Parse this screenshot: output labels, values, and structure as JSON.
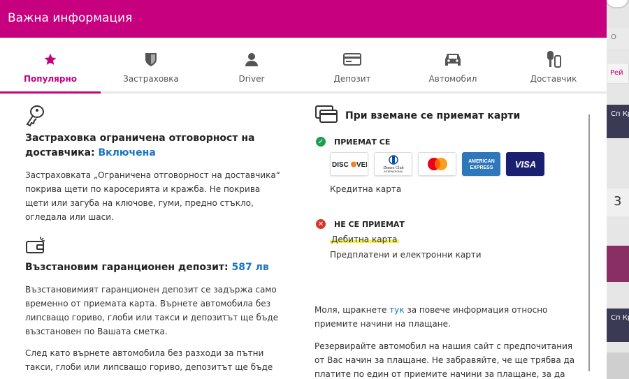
{
  "modal": {
    "title": "Важна информация"
  },
  "tabs": [
    {
      "label": "Популярно",
      "icon": "star-icon",
      "active": true
    },
    {
      "label": "Застраховка",
      "icon": "shield-icon",
      "active": false
    },
    {
      "label": "Driver",
      "icon": "person-icon",
      "active": false
    },
    {
      "label": "Депозит",
      "icon": "card-icon",
      "active": false
    },
    {
      "label": "Автомобил",
      "icon": "car-icon",
      "active": false
    },
    {
      "label": "Доставчик",
      "icon": "keys-icon",
      "active": false
    }
  ],
  "insurance": {
    "title": "Застраховка ограничена отговорност на доставчика:",
    "status": "Включена",
    "body": "Застраховката „Ограничена отговорност на доставчика“ покрива щети по каросерията и кражба. Не покрива щети или загуба на ключове, гуми, предно стъкло, огледала или шаси."
  },
  "deposit": {
    "title": "Възстановим гаранционен депозит:",
    "amount": "587 лв",
    "body1": "Възстановимият гаранционен депозит се задържа само временно от приемата карта. Върнете автомобила без липсващо гориво, глоби или такси и депозитът ще бъде възстановен по Вашата сметка.",
    "body2": "След като върнете автомобила без разходи за пътни такси, глоби или липсващо гориво, депозитът ще бъде"
  },
  "payment": {
    "title": "При вземане се приемат карти",
    "accepted_label": "ПРИЕМАТ СЕ",
    "accepted_cards": [
      "DISCOVER",
      "Diners Club INTERNATIONAL",
      "Mastercard",
      "AMERICAN EXPRESS",
      "VISA"
    ],
    "accepted_text": "Кредитна карта",
    "rejected_label": "НЕ СЕ ПРИЕМАТ",
    "rejected_items": [
      "Дебитна карта",
      "Предплатени и електронни карти"
    ]
  },
  "notes": {
    "p1_before": "Моля, щракнете",
    "p1_link": "тук",
    "p1_after": "за повече информация относно приемите начини на плащане.",
    "p2": "Резервирайте автомобил на нашия сайт с предпочитания от Вас начин за плащане. Не забравяйте, че ще трябва да платите по един от приемите начини за плащане, за да"
  },
  "background": {
    "strip_o": "О",
    "strip_rei": "Рей",
    "strip_sp1": "Сп Кр",
    "strip_num": "3",
    "strip_sp2": "Сп Кр"
  },
  "colors": {
    "brand": "#c6007e",
    "link": "#1a73c6",
    "ok": "#1f9d55",
    "no": "#d9342b",
    "highlight": "#f7f04a"
  }
}
